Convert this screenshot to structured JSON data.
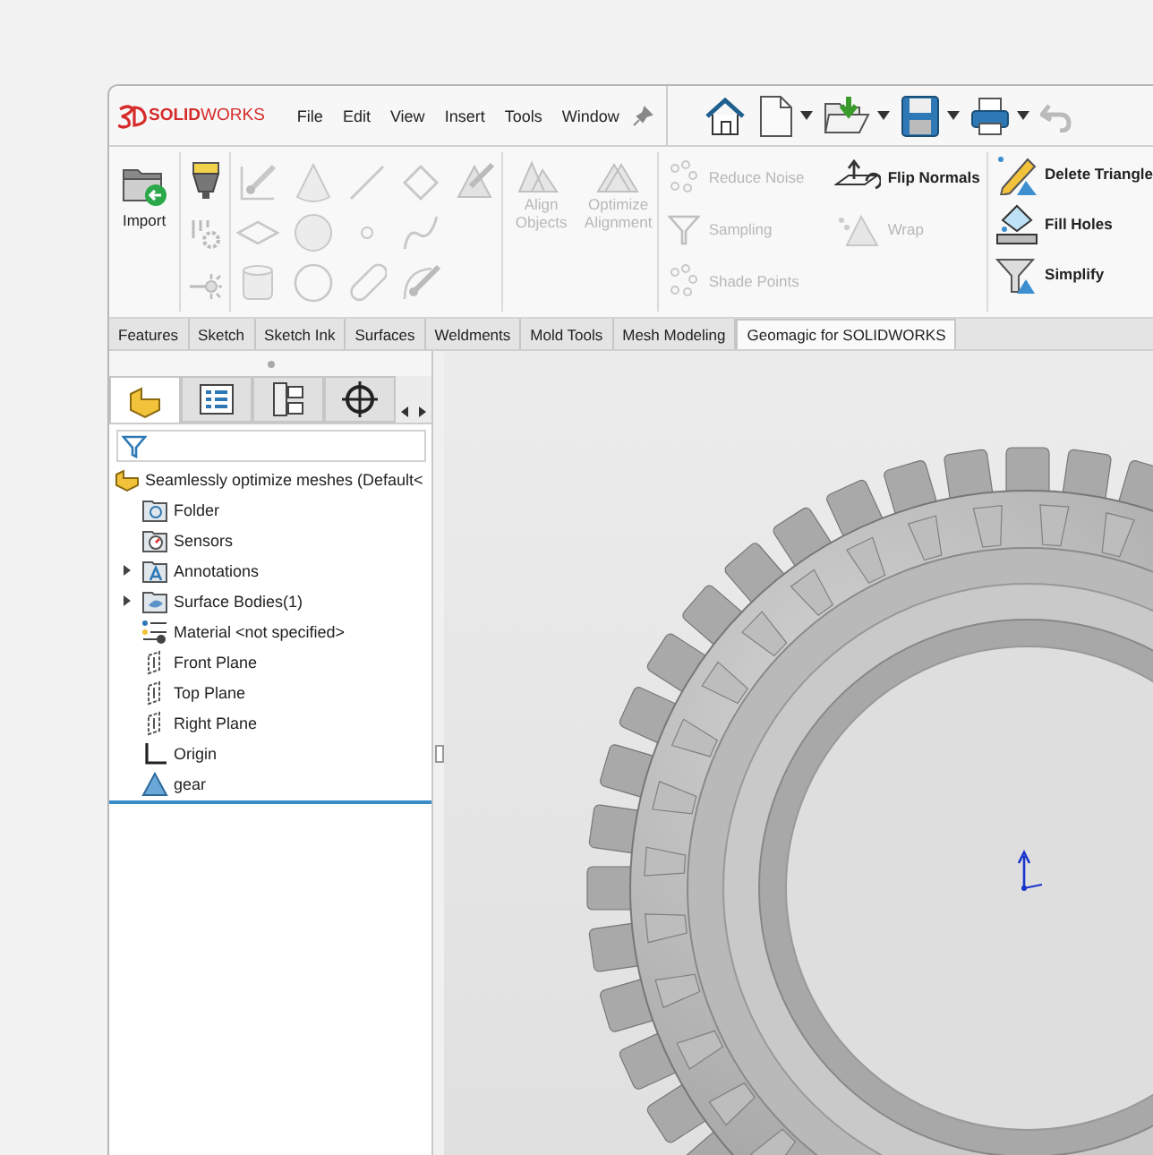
{
  "app": {
    "logo": "**SOLID**WORKS"
  },
  "menu": [
    "File",
    "Edit",
    "View",
    "Insert",
    "Tools",
    "Window"
  ],
  "ribbon": {
    "import": {
      "label": "Import"
    },
    "align_tools": [
      {
        "label": "Align Objects",
        "disabled": true
      },
      {
        "label": "Optimize Alignment",
        "disabled": true
      }
    ],
    "point_tools": [
      {
        "label": "Reduce Noise",
        "disabled": true
      },
      {
        "label": "Sampling",
        "disabled": true
      },
      {
        "label": "Shade Points",
        "disabled": true
      }
    ],
    "normal_tools": [
      {
        "label": "Flip Normals",
        "disabled": false
      },
      {
        "label": "Wrap",
        "disabled": true
      }
    ],
    "triangle_tools": [
      {
        "label": "Delete Triangle",
        "disabled": false
      },
      {
        "label": "Fill Holes",
        "disabled": false
      },
      {
        "label": "Simplify",
        "disabled": false
      }
    ]
  },
  "command_tabs": [
    {
      "label": "Features",
      "selected": false
    },
    {
      "label": "Sketch",
      "selected": false
    },
    {
      "label": "Sketch Ink",
      "selected": false
    },
    {
      "label": "Surfaces",
      "selected": false
    },
    {
      "label": "Weldments",
      "selected": false
    },
    {
      "label": "Mold Tools",
      "selected": false
    },
    {
      "label": "Mesh Modeling",
      "selected": false
    },
    {
      "label": "Geomagic for SOLIDWORKS",
      "selected": true
    }
  ],
  "panel_tabs": [
    {
      "kind": "feature",
      "selected": true
    },
    {
      "kind": "property",
      "selected": false
    },
    {
      "kind": "config",
      "selected": false
    },
    {
      "kind": "dimxpert",
      "selected": false
    }
  ],
  "feature_tree": {
    "root": "Seamlessly optimize meshes  (Default<",
    "items": [
      {
        "kind": "folder",
        "label": "Folder"
      },
      {
        "kind": "sensors",
        "label": "Sensors"
      },
      {
        "kind": "annotations",
        "label": "Annotations",
        "expanded": false
      },
      {
        "kind": "bodies",
        "label": "Surface Bodies(1)",
        "expanded": false
      },
      {
        "kind": "material",
        "label": "Material <not specified>"
      },
      {
        "kind": "plane",
        "label": "Front Plane"
      },
      {
        "kind": "plane",
        "label": "Top Plane"
      },
      {
        "kind": "plane",
        "label": "Right Plane"
      },
      {
        "kind": "origin",
        "label": "Origin"
      },
      {
        "kind": "mesh",
        "label": "gear"
      }
    ]
  }
}
